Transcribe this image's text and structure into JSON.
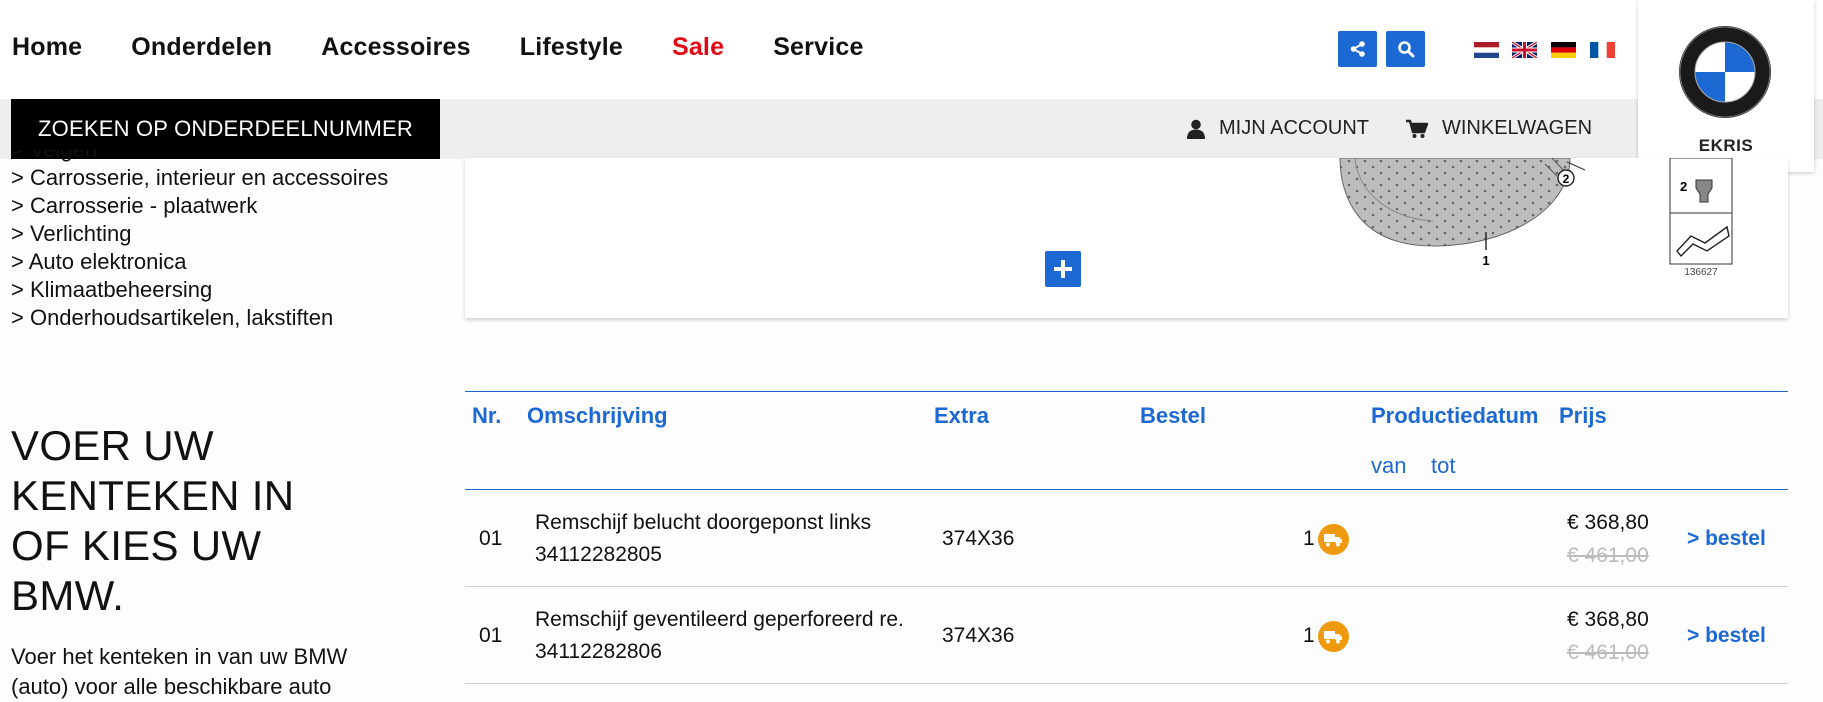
{
  "nav": {
    "items": [
      "Home",
      "Onderdelen",
      "Accessoires",
      "Lifestyle",
      "Sale",
      "Service"
    ]
  },
  "header": {
    "share_icon": "share-icon",
    "search_icon": "search-icon",
    "flags": [
      "flag-nl",
      "flag-gb",
      "flag-de",
      "flag-fr"
    ],
    "search_by_part_label": "ZOEKEN OP ONDERDEELNUMMER",
    "account_label": "MIJN ACCOUNT",
    "cart_label": "WINKELWAGEN",
    "brand_label": "EKRIS",
    "accent": "#1c69d3",
    "sale_color": "#e30613"
  },
  "sidebar": {
    "categories": [
      "> Velgen",
      "> Carrosserie, interieur en accessoires",
      "> Carrosserie - plaatwerk",
      "> Verlichting",
      "> Auto elektronica",
      "> Klimaatbeheersing",
      "> Onderhoudsartikelen, lakstiften"
    ],
    "heading_lines": [
      "VOER UW",
      "KENTEKEN IN",
      "OF KIES UW",
      "BMW."
    ],
    "paragraph": "Voer het kenteken in van uw BMW (auto) voor alle beschikbare auto"
  },
  "diagram": {
    "callouts": [
      "1",
      "2",
      "2"
    ],
    "image_code": "136627"
  },
  "table": {
    "headers": {
      "nr": "Nr.",
      "omschrijving": "Omschrijving",
      "extra": "Extra",
      "bestel": "Bestel",
      "productiedatum": "Productiedatum",
      "prijs": "Prijs"
    },
    "subheaders": {
      "van": "van",
      "tot": "tot"
    },
    "rows": [
      {
        "nr": "01",
        "description": "Remschijf belucht doorgeponst links",
        "part_number": "34112282805",
        "extra": "374X36",
        "quantity": "1",
        "price": "€ 368,80",
        "old_price": "€ 461,00",
        "order_label": "> bestel"
      },
      {
        "nr": "01",
        "description": "Remschijf geventileerd geperforeerd re.",
        "part_number": "34112282806",
        "extra": "374X36",
        "quantity": "1",
        "price": "€ 368,80",
        "old_price": "€ 461,00",
        "order_label": "> bestel"
      }
    ]
  }
}
